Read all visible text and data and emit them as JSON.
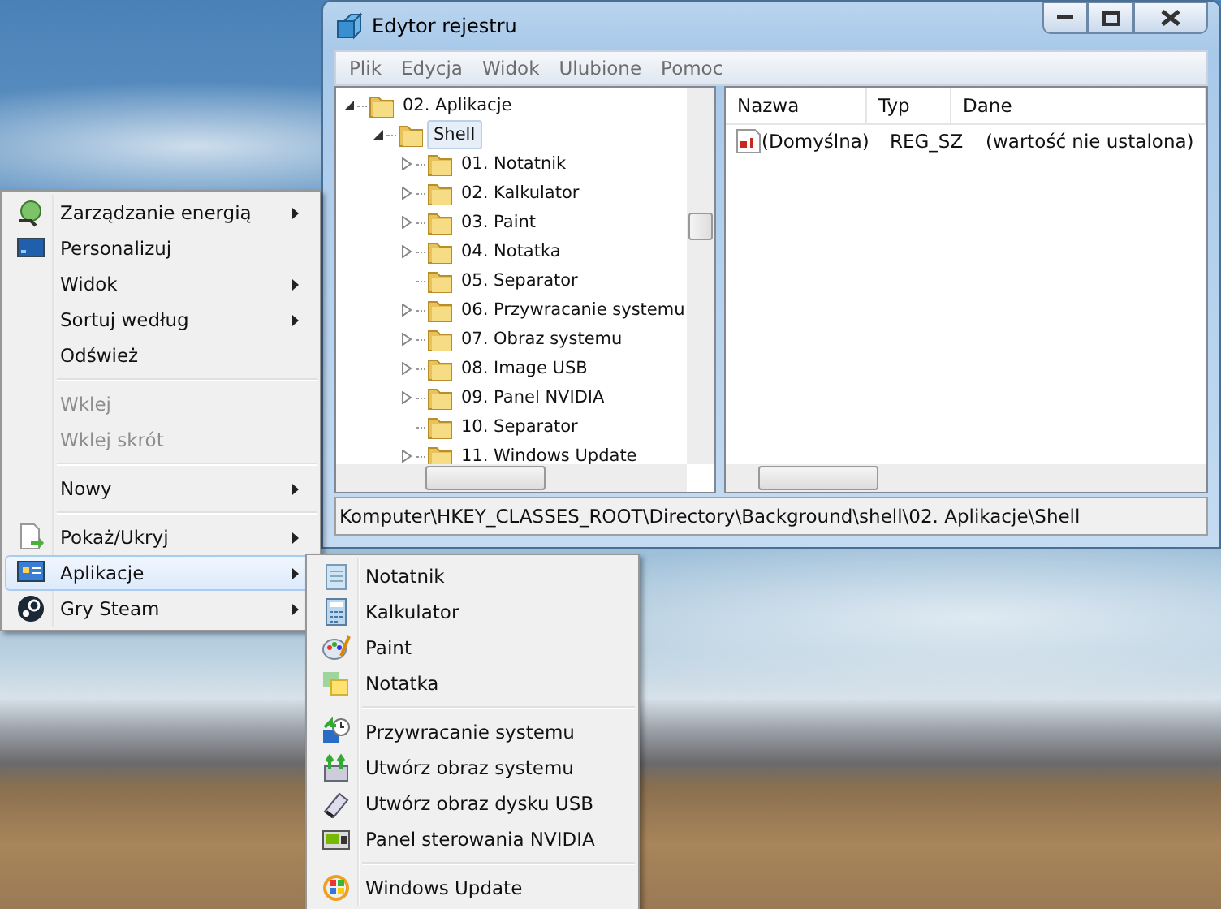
{
  "window": {
    "title": "Edytor rejestru",
    "menu": [
      "Plik",
      "Edycja",
      "Widok",
      "Ulubione",
      "Pomoc"
    ],
    "tree": [
      {
        "label": "02. Aplikacje",
        "expanded": true,
        "selected": false,
        "children": [
          {
            "label": "Shell",
            "expanded": true,
            "selected": true,
            "children": [
              {
                "label": "01. Notatnik",
                "expandable": true,
                "selected": false
              },
              {
                "label": "02. Kalkulator",
                "expandable": true,
                "selected": false
              },
              {
                "label": "03. Paint",
                "expandable": true,
                "selected": false
              },
              {
                "label": "04. Notatka",
                "expandable": true,
                "selected": false
              },
              {
                "label": "05. Separator",
                "expandable": false,
                "selected": false
              },
              {
                "label": "06. Przywracanie systemu",
                "expandable": true,
                "selected": false
              },
              {
                "label": "07. Obraz systemu",
                "expandable": true,
                "selected": false
              },
              {
                "label": "08. Image USB",
                "expandable": true,
                "selected": false
              },
              {
                "label": "09. Panel NVIDIA",
                "expandable": true,
                "selected": false
              },
              {
                "label": "10. Separator",
                "expandable": false,
                "selected": false
              },
              {
                "label": "11. Windows Update",
                "expandable": true,
                "selected": false
              }
            ]
          }
        ]
      }
    ],
    "values": {
      "columns": [
        "Nazwa",
        "Typ",
        "Dane"
      ],
      "rows": [
        {
          "name": "(Domyślna)",
          "type": "REG_SZ",
          "data": "(wartość nie ustalona)"
        }
      ]
    },
    "status_bar": "Komputer\\HKEY_CLASSES_ROOT\\Directory\\Background\\shell\\02. Aplikacje\\Shell"
  },
  "context_menu": {
    "items": [
      {
        "kind": "item",
        "label": "Zarządzanie energią",
        "submenu": true,
        "disabled": false,
        "selected": false
      },
      {
        "kind": "item",
        "label": "Personalizuj",
        "submenu": false,
        "disabled": false,
        "selected": false
      },
      {
        "kind": "item",
        "label": "Widok",
        "submenu": true,
        "disabled": false,
        "selected": false
      },
      {
        "kind": "item",
        "label": "Sortuj według",
        "submenu": true,
        "disabled": false,
        "selected": false
      },
      {
        "kind": "item",
        "label": "Odśwież",
        "submenu": false,
        "disabled": false,
        "selected": false
      },
      {
        "kind": "separator"
      },
      {
        "kind": "item",
        "label": "Wklej",
        "submenu": false,
        "disabled": true,
        "selected": false
      },
      {
        "kind": "item",
        "label": "Wklej skrót",
        "submenu": false,
        "disabled": true,
        "selected": false
      },
      {
        "kind": "separator"
      },
      {
        "kind": "item",
        "label": "Nowy",
        "submenu": true,
        "disabled": false,
        "selected": false
      },
      {
        "kind": "separator"
      },
      {
        "kind": "item",
        "label": "Pokaż/Ukryj",
        "submenu": true,
        "disabled": false,
        "selected": false
      },
      {
        "kind": "item",
        "label": "Aplikacje",
        "submenu": true,
        "disabled": false,
        "selected": true
      },
      {
        "kind": "item",
        "label": "Gry Steam",
        "submenu": true,
        "disabled": false,
        "selected": false
      }
    ]
  },
  "submenu": {
    "items": [
      {
        "kind": "item",
        "label": "Notatnik"
      },
      {
        "kind": "item",
        "label": "Kalkulator"
      },
      {
        "kind": "item",
        "label": "Paint"
      },
      {
        "kind": "item",
        "label": "Notatka"
      },
      {
        "kind": "separator"
      },
      {
        "kind": "item",
        "label": "Przywracanie systemu"
      },
      {
        "kind": "item",
        "label": "Utwórz obraz systemu"
      },
      {
        "kind": "item",
        "label": "Utwórz obraz dysku USB"
      },
      {
        "kind": "item",
        "label": "Panel sterowania NVIDIA"
      },
      {
        "kind": "separator"
      },
      {
        "kind": "item",
        "label": "Windows Update"
      }
    ]
  }
}
